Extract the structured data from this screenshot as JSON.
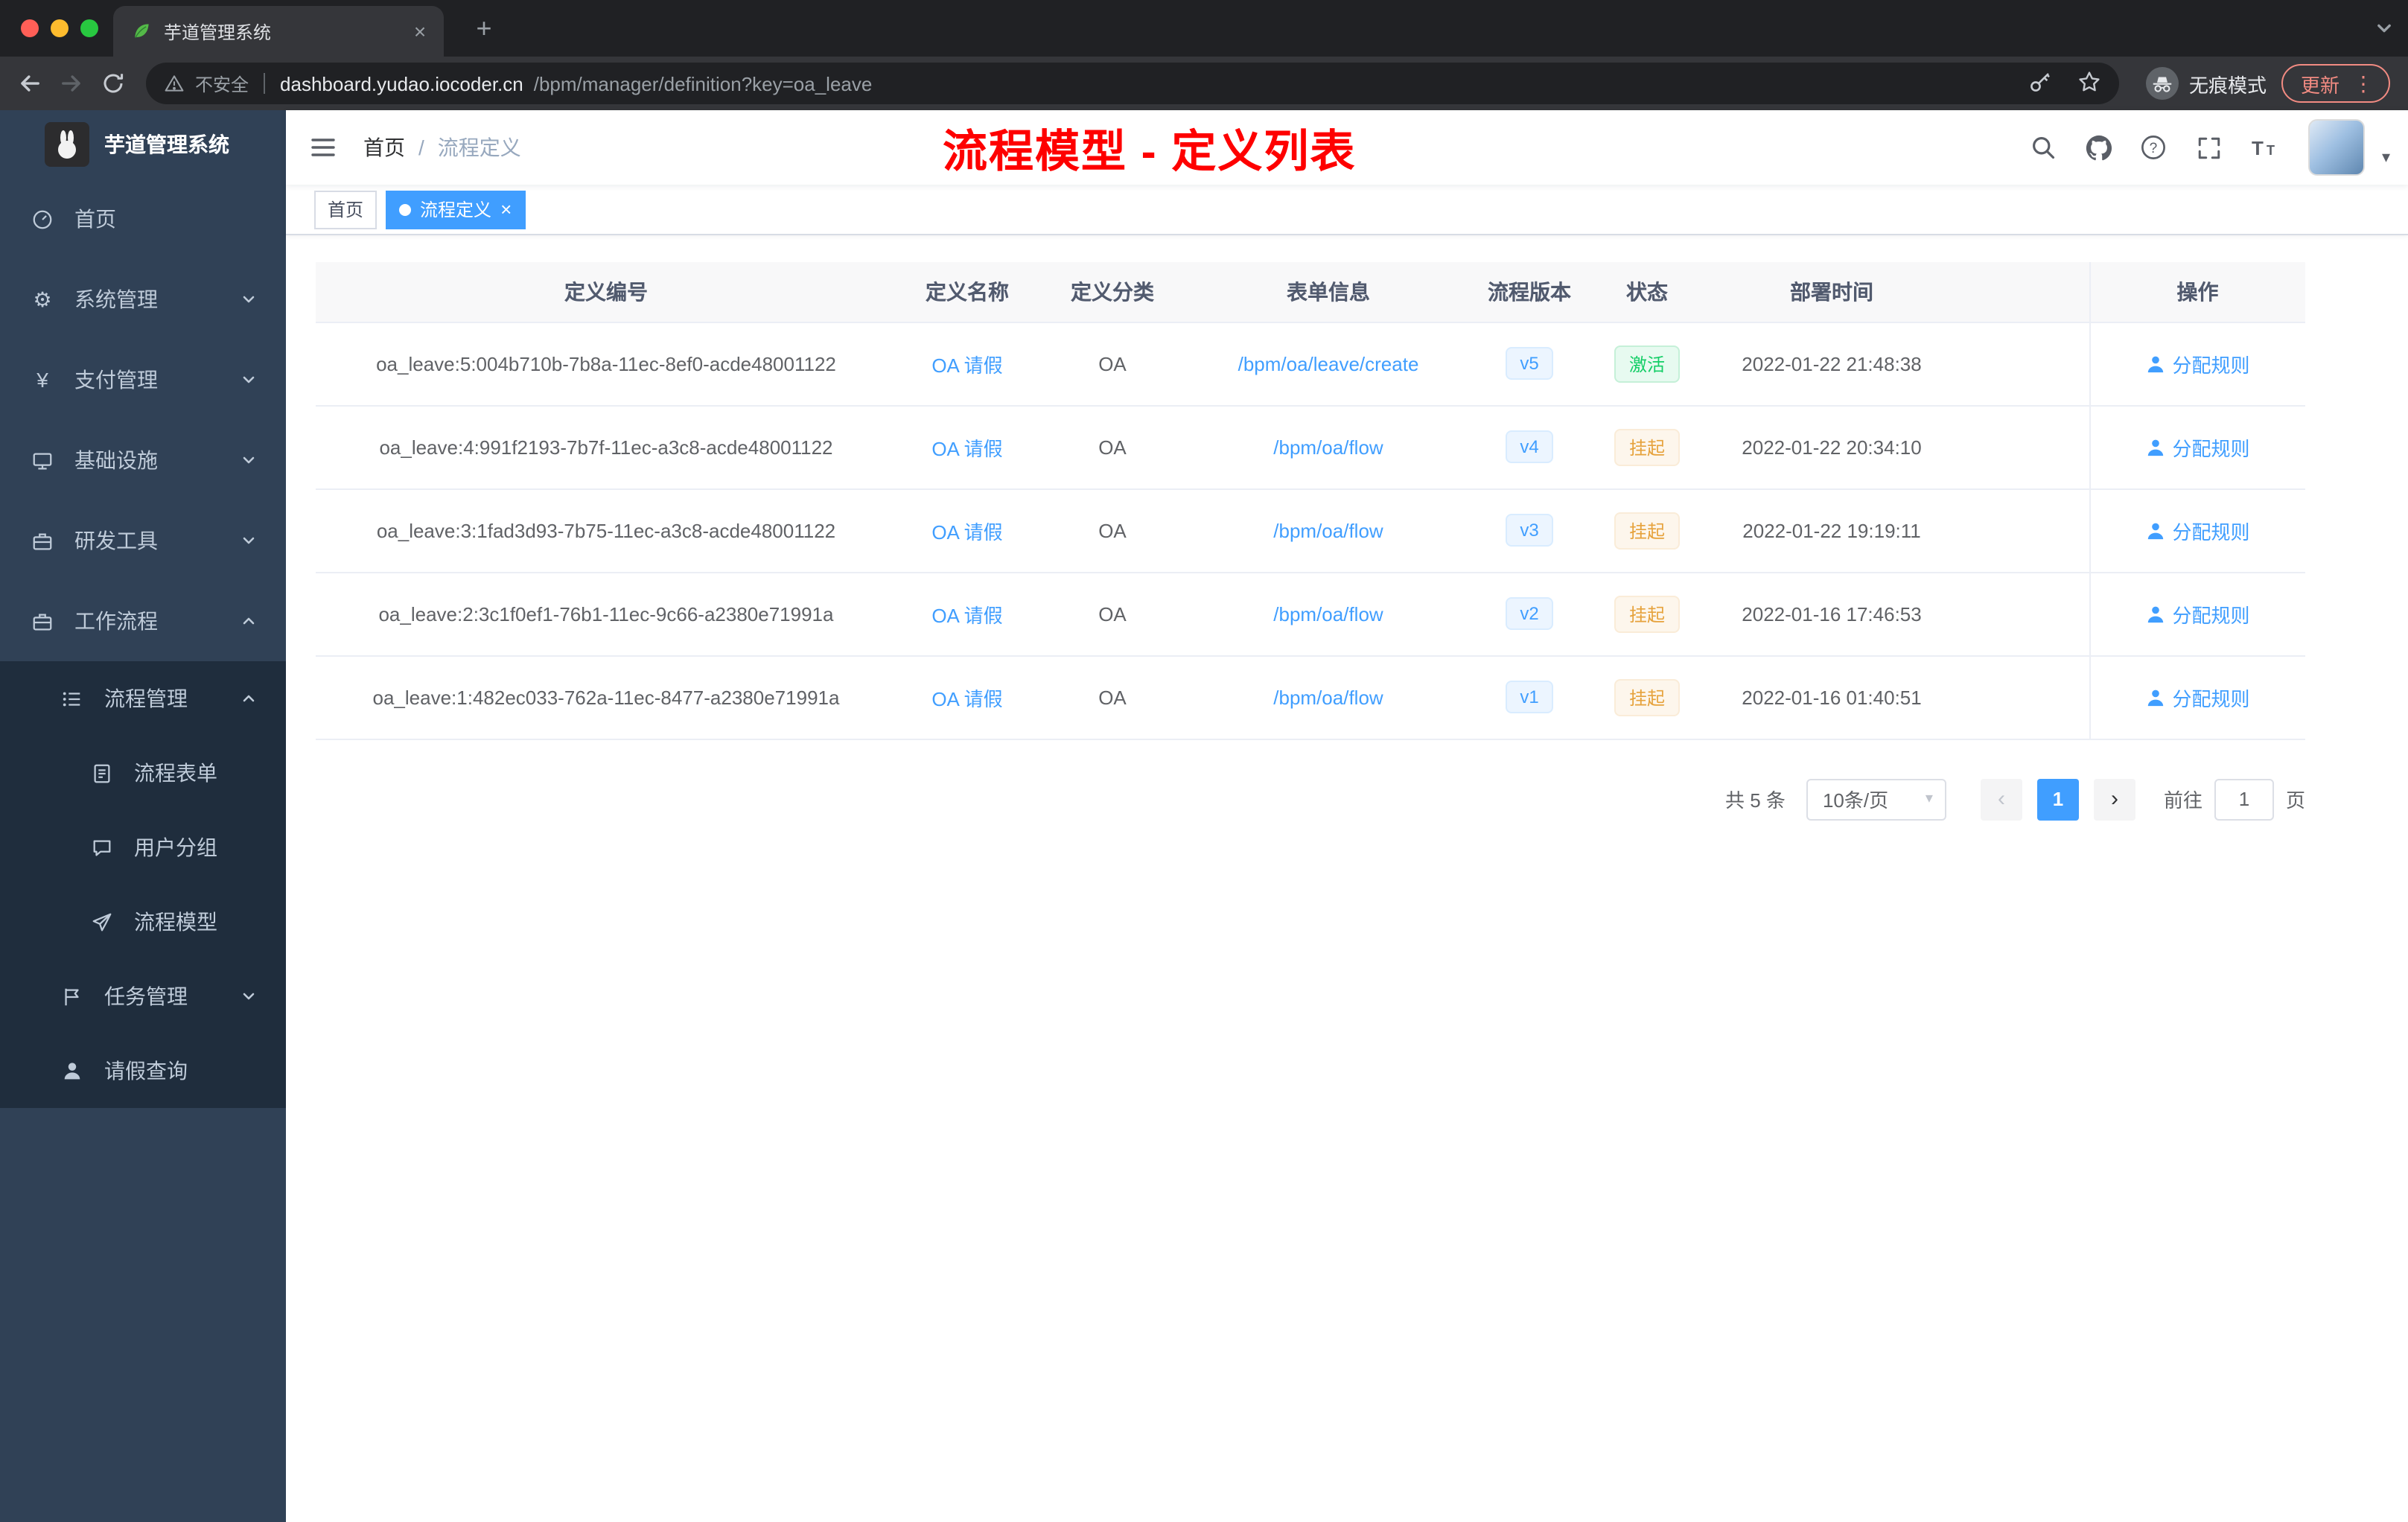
{
  "colors": {
    "accent": "#409eff",
    "success": "#13ce66",
    "warning": "#e6a23c",
    "annotation_red": "#fe0000",
    "sidebar_bg": "#304156",
    "submenu_bg": "#1f2d3d"
  },
  "browser": {
    "tab_title": "芋道管理系统",
    "insecure_label": "不安全",
    "url_domain": "dashboard.yudao.iocoder.cn",
    "url_path": "/bpm/manager/definition?key=oa_leave",
    "incognito_label": "无痕模式",
    "update_label": "更新"
  },
  "sidebar": {
    "logo_title": "芋道管理系统",
    "items": [
      {
        "label": "首页"
      },
      {
        "label": "系统管理"
      },
      {
        "label": "支付管理"
      },
      {
        "label": "基础设施"
      },
      {
        "label": "研发工具"
      },
      {
        "label": "工作流程"
      }
    ],
    "workflow": {
      "process_mgmt": {
        "label": "流程管理"
      },
      "process_children": [
        {
          "label": "流程表单"
        },
        {
          "label": "用户分组"
        },
        {
          "label": "流程模型"
        }
      ],
      "task_mgmt": {
        "label": "任务管理"
      },
      "leave_query": {
        "label": "请假查询"
      }
    }
  },
  "navbar": {
    "breadcrumb_home": "首页",
    "breadcrumb_separator": "/",
    "breadcrumb_current": "流程定义",
    "annotation": "流程模型 - 定义列表"
  },
  "tags": [
    {
      "label": "首页"
    },
    {
      "label": "流程定义"
    }
  ],
  "table": {
    "headers": [
      "定义编号",
      "定义名称",
      "定义分类",
      "表单信息",
      "流程版本",
      "状态",
      "部署时间",
      "操作"
    ],
    "rows": [
      {
        "id": "oa_leave:5:004b710b-7b8a-11ec-8ef0-acde48001122",
        "name": "OA 请假",
        "category": "OA",
        "form": "/bpm/oa/leave/create",
        "version": "v5",
        "status": "激活",
        "status_type": "success",
        "deploy_time": "2022-01-22 21:48:38",
        "action": "分配规则"
      },
      {
        "id": "oa_leave:4:991f2193-7b7f-11ec-a3c8-acde48001122",
        "name": "OA 请假",
        "category": "OA",
        "form": "/bpm/oa/flow",
        "version": "v4",
        "status": "挂起",
        "status_type": "warning",
        "deploy_time": "2022-01-22 20:34:10",
        "action": "分配规则"
      },
      {
        "id": "oa_leave:3:1fad3d93-7b75-11ec-a3c8-acde48001122",
        "name": "OA 请假",
        "category": "OA",
        "form": "/bpm/oa/flow",
        "version": "v3",
        "status": "挂起",
        "status_type": "warning",
        "deploy_time": "2022-01-22 19:19:11",
        "action": "分配规则"
      },
      {
        "id": "oa_leave:2:3c1f0ef1-76b1-11ec-9c66-a2380e71991a",
        "name": "OA 请假",
        "category": "OA",
        "form": "/bpm/oa/flow",
        "version": "v2",
        "status": "挂起",
        "status_type": "warning",
        "deploy_time": "2022-01-16 17:46:53",
        "action": "分配规则"
      },
      {
        "id": "oa_leave:1:482ec033-762a-11ec-8477-a2380e71991a",
        "name": "OA 请假",
        "category": "OA",
        "form": "/bpm/oa/flow",
        "version": "v1",
        "status": "挂起",
        "status_type": "warning",
        "deploy_time": "2022-01-16 01:40:51",
        "action": "分配规则"
      }
    ]
  },
  "pagination": {
    "total": "共 5 条",
    "page_size": "10条/页",
    "current_page": "1",
    "goto_label": "前往",
    "goto_value": "1",
    "page_unit": "页"
  }
}
